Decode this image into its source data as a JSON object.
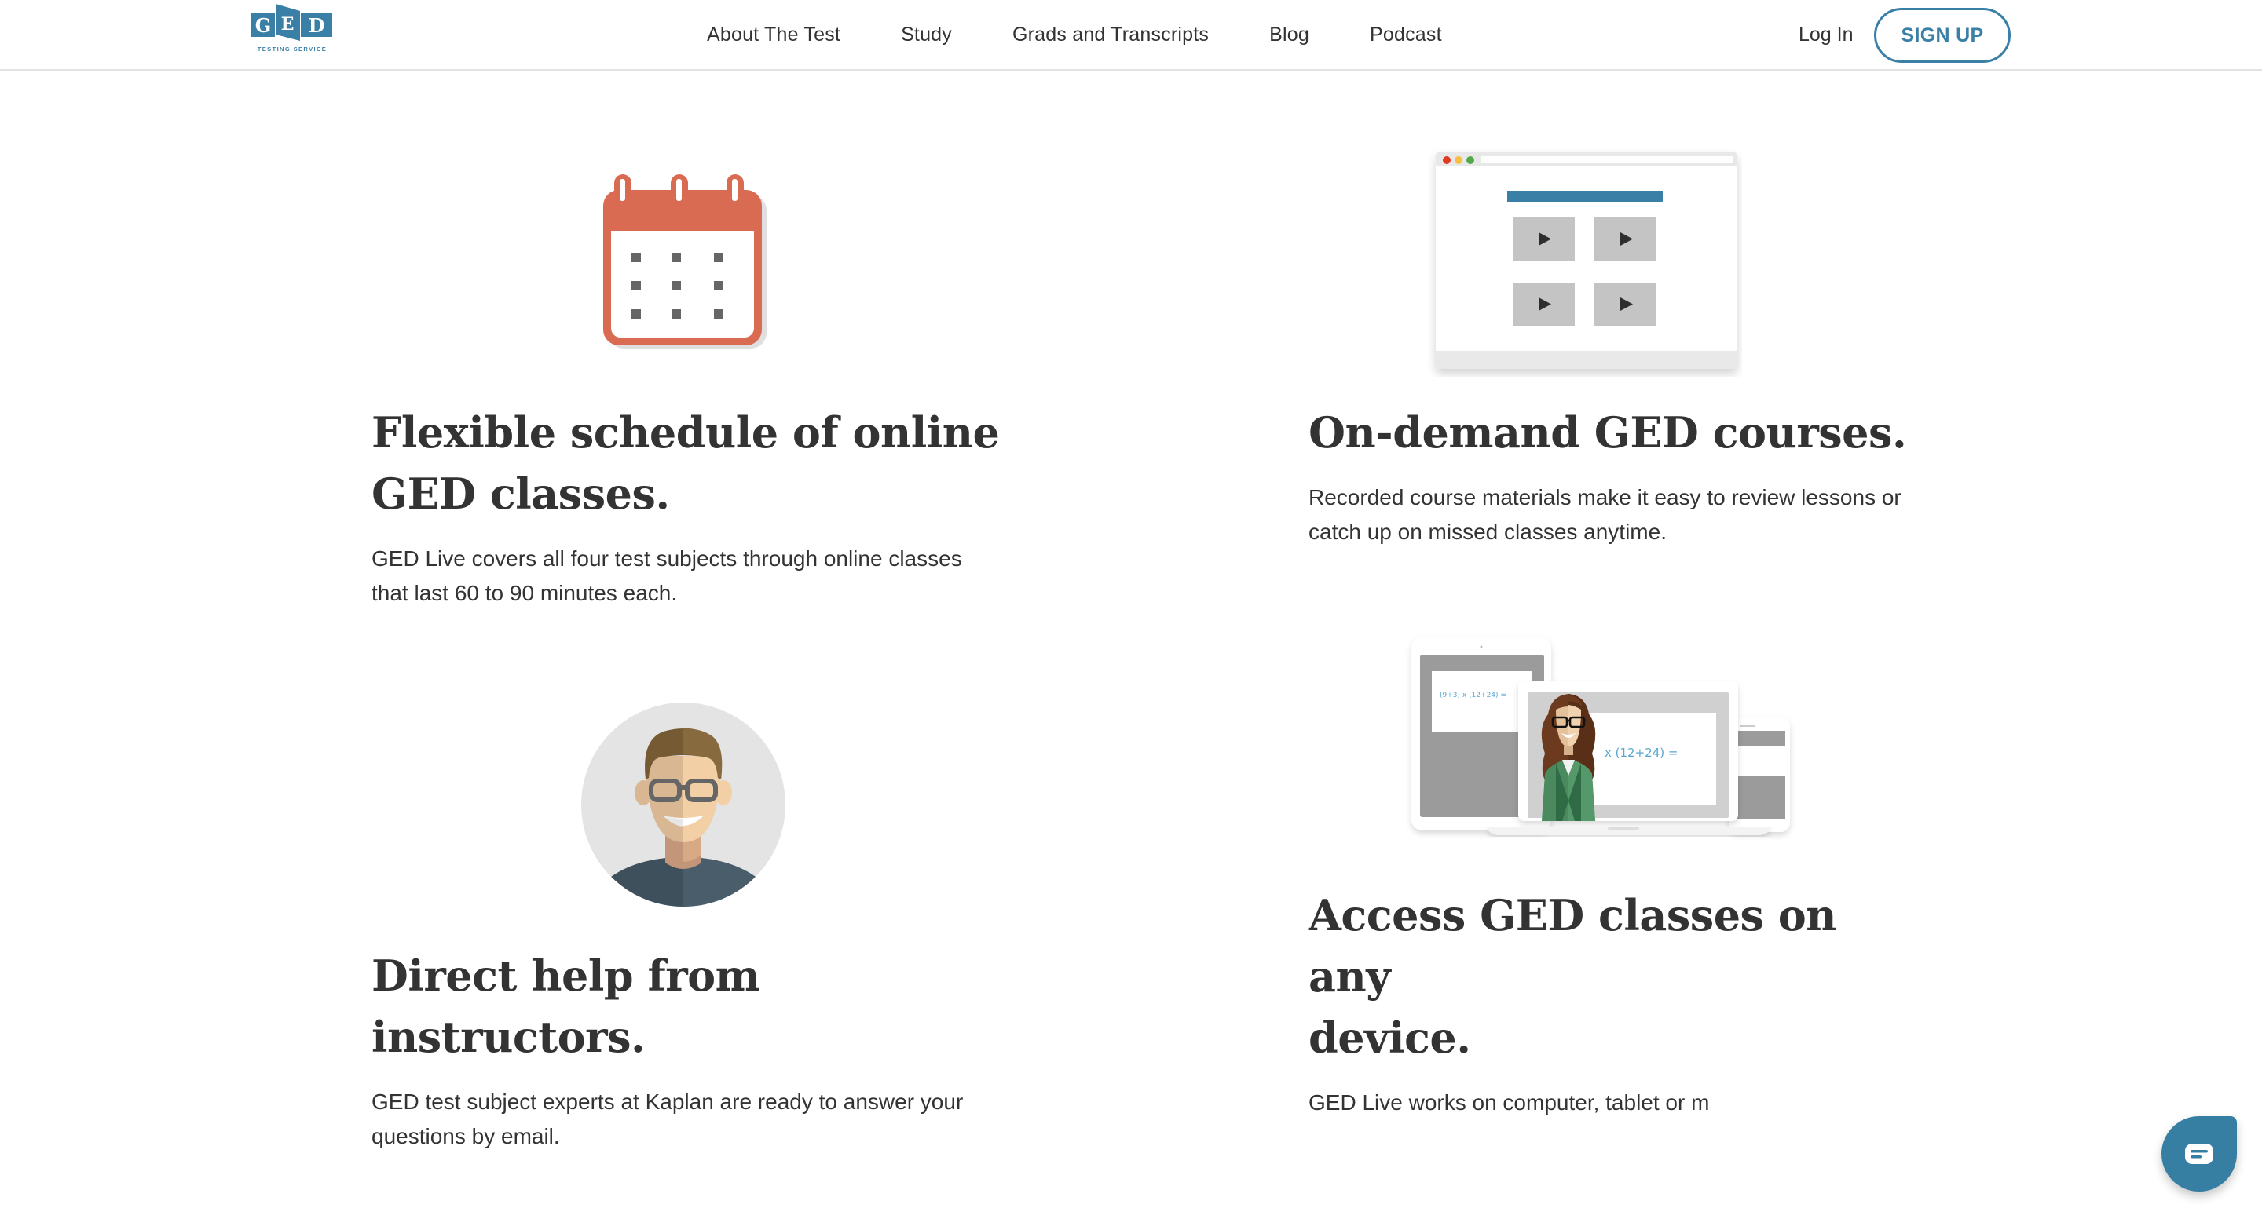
{
  "header": {
    "logo": {
      "letters": [
        "G",
        "E",
        "D"
      ],
      "tagline": "TESTING SERVICE",
      "alt": "GED Testing Service"
    },
    "nav": [
      {
        "label": "About The Test"
      },
      {
        "label": "Study"
      },
      {
        "label": "Grads and Transcripts"
      },
      {
        "label": "Blog"
      },
      {
        "label": "Podcast"
      }
    ],
    "login_label": "Log In",
    "signup_label": "SIGN UP"
  },
  "features": [
    {
      "icon": "calendar-icon",
      "heading_line1": "Flexible schedule of online",
      "heading_line2": "GED classes.",
      "body": "GED Live covers all four test subjects through online classes that last 60 to 90 minutes each."
    },
    {
      "icon": "video-course-browser-icon",
      "heading_line1": "On-demand GED courses.",
      "heading_line2": "",
      "body": "Recorded course materials make it easy to review lessons or catch up on missed classes anytime."
    },
    {
      "icon": "instructor-avatar-icon",
      "heading_line1": "Direct help from instructors.",
      "heading_line2": "",
      "body": "GED test subject experts at Kaplan are ready to answer your questions by email."
    },
    {
      "icon": "multi-device-icon",
      "heading_line1": "Access GED classes on any",
      "heading_line2": "device.",
      "body": "GED Live works on computer, tablet or m",
      "equation": "(9+3) x (12+24) =",
      "equation_short": "x (12+24) ="
    }
  ],
  "chat": {
    "icon": "chat-bubble-icon",
    "label": "Chat"
  },
  "colors": {
    "brand": "#3a7fa5",
    "calendar": "#d96b53",
    "text": "#333333",
    "chat": "#377ea3"
  }
}
